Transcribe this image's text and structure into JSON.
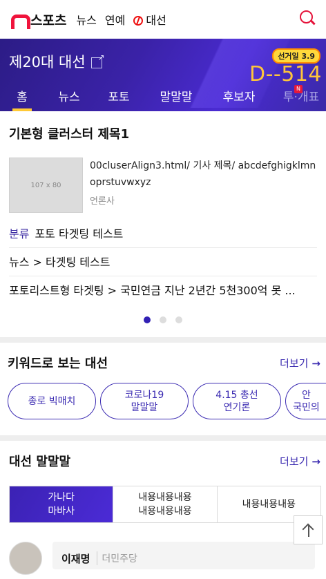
{
  "header": {
    "brand": "스포츠",
    "nav": [
      "뉴스",
      "연예",
      "대선"
    ]
  },
  "banner": {
    "title": "제20대 대선",
    "badge": "선거일 3.9",
    "dday": "D--514",
    "tabs": [
      "홈",
      "뉴스",
      "포토",
      "말말말",
      "후보자",
      "투·개표"
    ],
    "tab_badge": "N"
  },
  "cluster": {
    "title": "기본형 클러스터 제목1",
    "thumb_label": "107 x 80",
    "article_title": "00cluserAlign3.html/ 기사 제목/ abcdefghigklmnoprstuvwxyz",
    "press": "언론사",
    "rows": [
      {
        "cat": "분류",
        "text": "포토 타겟팅 테스트"
      },
      {
        "cat": "",
        "text": "뉴스 > 타겟팅 테스트"
      },
      {
        "cat": "",
        "text": "포토리스트형 타겟팅 > 국민연금 지난 2년간 5천300억 못 ..."
      }
    ]
  },
  "keywords": {
    "title": "키워드로 보는 대선",
    "more": "더보기",
    "pills": [
      "종로 빅매치",
      "코로나19\n말말말",
      "4.15 총선\n연기론",
      "안\n국민의"
    ]
  },
  "statements": {
    "title": "대선 말말말",
    "more": "더보기",
    "segments": [
      "가나다\n마바사",
      "내용내용내용\n내용내용내용",
      "내용내용내용"
    ],
    "person_name": "이재명",
    "person_party": "더민주당"
  },
  "colors": {
    "accent": "#3b2bb2",
    "brand_red": "#f0143c",
    "dday_yellow": "#ffc53b"
  }
}
